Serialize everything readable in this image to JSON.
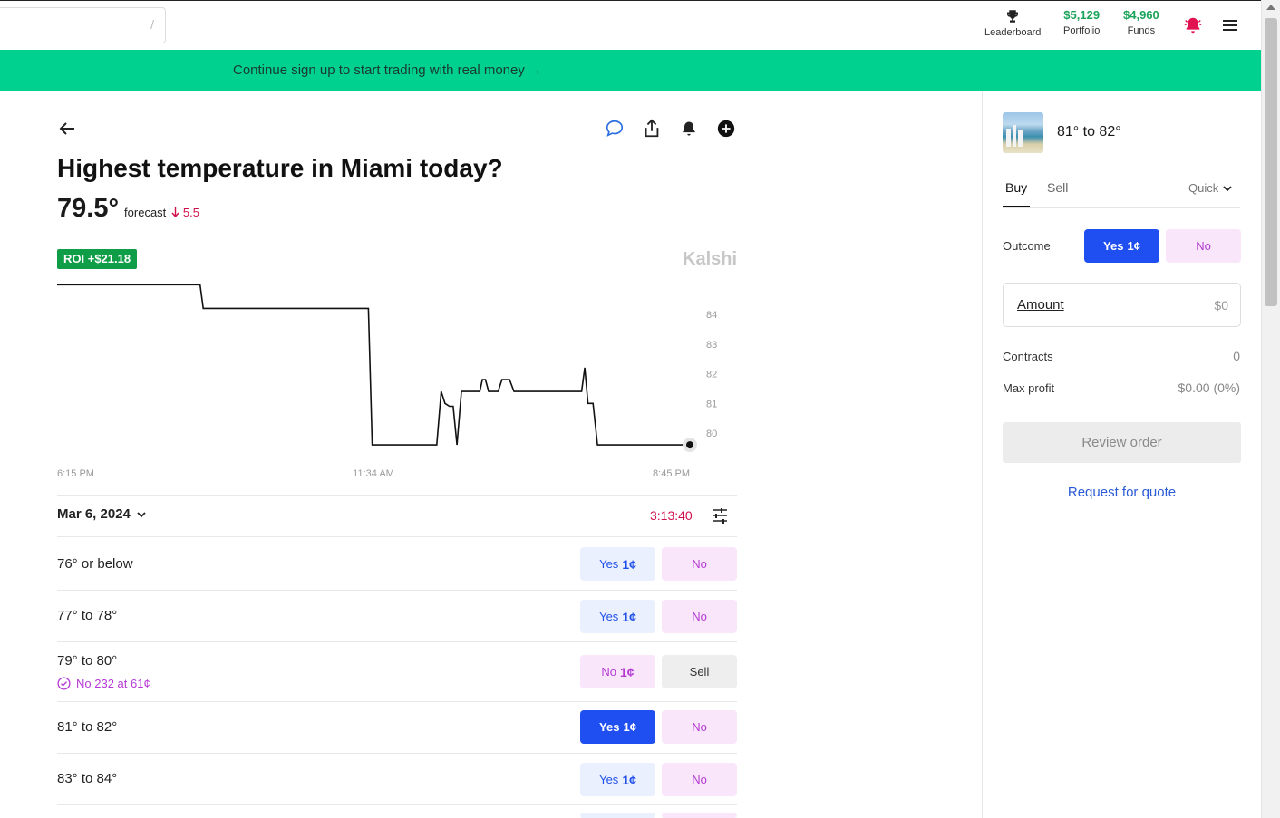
{
  "topbar": {
    "search_hint": "/",
    "leaderboard_label": "Leaderboard",
    "portfolio_value": "$5,129",
    "portfolio_label": "Portfolio",
    "funds_value": "$4,960",
    "funds_label": "Funds"
  },
  "banner": {
    "text": "Continue sign up to start trading with real money →"
  },
  "market": {
    "title": "Highest temperature in Miami today?",
    "forecast_value": "79.5°",
    "forecast_label": "forecast",
    "forecast_change": "5.5",
    "roi_badge": "ROI +$21.18",
    "brand": "Kalshi",
    "date": "Mar 6, 2024",
    "timer": "3:13:40"
  },
  "chart_data": {
    "type": "line",
    "x_tick_labels": [
      "6:15 PM",
      "11:34 AM",
      "8:45 PM"
    ],
    "y_tick_labels": [
      "84",
      "83",
      "82",
      "81",
      "80"
    ],
    "y_ticks": [
      84,
      83,
      82,
      81,
      80
    ],
    "ylim": [
      79.4,
      84.2
    ],
    "xlim": [
      0,
      100
    ],
    "x_tick_positions": [
      0,
      50,
      100
    ],
    "grid": false,
    "series": [
      {
        "values": [
          [
            0,
            85.0
          ],
          [
            22.6,
            85.0
          ],
          [
            23.1,
            84.2
          ],
          [
            49.2,
            84.2
          ],
          [
            49.8,
            79.6
          ],
          [
            60.0,
            79.6
          ],
          [
            60.7,
            81.4
          ],
          [
            61.3,
            81.0
          ],
          [
            62.0,
            80.9
          ],
          [
            62.6,
            80.9
          ],
          [
            63.2,
            79.6
          ],
          [
            63.9,
            81.4
          ],
          [
            66.8,
            81.4
          ],
          [
            67.2,
            81.8
          ],
          [
            67.7,
            81.8
          ],
          [
            68.2,
            81.4
          ],
          [
            69.7,
            81.4
          ],
          [
            70.3,
            81.8
          ],
          [
            71.5,
            81.8
          ],
          [
            72.2,
            81.4
          ],
          [
            82.9,
            81.4
          ],
          [
            83.4,
            82.2
          ],
          [
            83.9,
            81.0
          ],
          [
            84.7,
            81.0
          ],
          [
            85.4,
            79.6
          ],
          [
            100,
            79.6
          ]
        ]
      }
    ]
  },
  "markets": [
    {
      "label": "76° or below",
      "yes": "Yes",
      "yes_price": "1¢",
      "no": "No",
      "sub": ""
    },
    {
      "label": "77° to 78°",
      "yes": "Yes",
      "yes_price": "1¢",
      "no": "No",
      "sub": ""
    },
    {
      "label": "79° to 80°",
      "yes": "No",
      "yes_price": "1¢",
      "no": "Sell",
      "sub": "No 232 at 61¢"
    },
    {
      "label": "81° to 82°",
      "yes": "Yes",
      "yes_price": "1¢",
      "no": "No",
      "sub": ""
    },
    {
      "label": "83° to 84°",
      "yes": "Yes",
      "yes_price": "1¢",
      "no": "No",
      "sub": ""
    }
  ],
  "order_panel": {
    "title": "81° to 82°",
    "tab_buy": "Buy",
    "tab_sell": "Sell",
    "mode": "Quick",
    "outcome_label": "Outcome",
    "yes_label": "Yes",
    "yes_price": "1¢",
    "no_label": "No",
    "amount_label": "Amount",
    "amount_value": "$0",
    "contracts_label": "Contracts",
    "contracts_value": "0",
    "max_profit_label": "Max profit",
    "max_profit_value": "$0.00 (0%)",
    "review_button": "Review order",
    "rfq_link": "Request for quote"
  },
  "colors": {
    "accent_green": "#00d18f",
    "primary_blue": "#1f4ff0",
    "no_purple": "#b43ad2",
    "alert_red": "#d0104c"
  }
}
